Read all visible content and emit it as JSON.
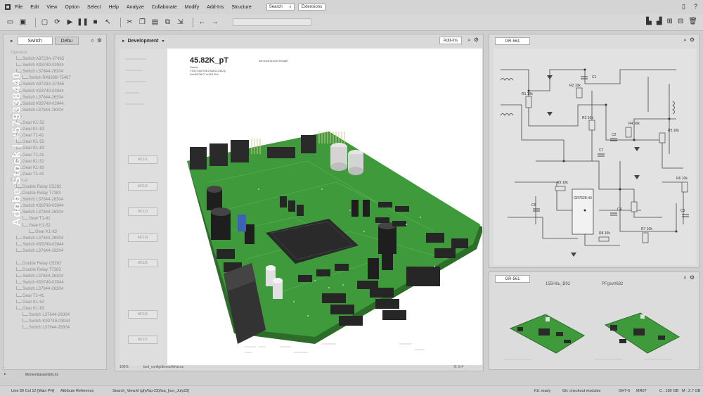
{
  "menu": [
    "File",
    "Edit",
    "View",
    "Option",
    "Select",
    "Help",
    "Analyze",
    "Collaborate",
    "Modify",
    "Add-Ins",
    "Structure"
  ],
  "menu_search": "Search",
  "menu_extensions": "Extensions",
  "toolbar_icons": [
    "folder-icon",
    "save-icon",
    "screen-icon",
    "sync-icon",
    "play-icon",
    "pause-icon",
    "stop-icon",
    "pointer-icon"
  ],
  "left_panel": {
    "tabs": [
      "Switch",
      "Debu"
    ],
    "tree": [
      {
        "label": "Operator",
        "indent": 0,
        "section": true
      },
      {
        "label": "Switch A9723A-37465",
        "indent": 1
      },
      {
        "label": "Switch K93749-03944",
        "indent": 1
      },
      {
        "label": "Switch L37644-26304",
        "indent": 1
      },
      {
        "label": "Switch R4838B-75467",
        "indent": 2
      },
      {
        "label": "Switch A9723A-37465",
        "indent": 1
      },
      {
        "label": "Switch K93749-03944",
        "indent": 1
      },
      {
        "label": "Switch L37644-26304",
        "indent": 1
      },
      {
        "label": "Switch K93749-03944",
        "indent": 1
      },
      {
        "label": "Switch L37644-26304",
        "indent": 1
      },
      {
        "label": "Gears",
        "indent": 0,
        "section": true
      },
      {
        "label": "Gear K1-52",
        "indent": 1
      },
      {
        "label": "Gear K1-83",
        "indent": 1
      },
      {
        "label": "Gear T1-41",
        "indent": 1
      },
      {
        "label": "Gear K1-52",
        "indent": 1
      },
      {
        "label": "Gear K1-83",
        "indent": 1
      },
      {
        "label": "Gear T1-41",
        "indent": 1
      },
      {
        "label": "Gear K1-52",
        "indent": 1
      },
      {
        "label": "Gear K1-83",
        "indent": 1
      },
      {
        "label": "Gear T1-41",
        "indent": 1
      },
      {
        "label": "Electrical",
        "indent": 0,
        "section": true
      },
      {
        "label": "Double Relay C5282",
        "indent": 1
      },
      {
        "label": "Double Relay T7383",
        "indent": 1
      },
      {
        "label": "Switch L37644-26304",
        "indent": 1
      },
      {
        "label": "Switch K93749-03944",
        "indent": 1
      },
      {
        "label": "Switch L37644-26304",
        "indent": 1
      },
      {
        "label": "Gear T1-41",
        "indent": 2
      },
      {
        "label": "Gear K1-52",
        "indent": 2
      },
      {
        "label": "Gear K1-83",
        "indent": 3
      },
      {
        "label": "Switch L37644-26304",
        "indent": 1
      },
      {
        "label": "Switch K93749-03944",
        "indent": 1
      },
      {
        "label": "Switch L37644-26304",
        "indent": 1
      },
      {
        "label": "",
        "indent": 0
      },
      {
        "label": "Double Relay C5282",
        "indent": 1
      },
      {
        "label": "Double Relay T7383",
        "indent": 1
      },
      {
        "label": "Switch L37644-26304",
        "indent": 1
      },
      {
        "label": "Switch K93749-03944",
        "indent": 1
      },
      {
        "label": "Switch L37644-26304",
        "indent": 1
      },
      {
        "label": "Gear T1-41",
        "indent": 1
      },
      {
        "label": "Gear K1-52",
        "indent": 1
      },
      {
        "label": "Gear K1-83",
        "indent": 1
      },
      {
        "label": "Switch L37644-26304",
        "indent": 2
      },
      {
        "label": "Switch K93749-03944",
        "indent": 2
      },
      {
        "label": "Switch L37644-26304",
        "indent": 2
      }
    ],
    "bottom_label": "Moment/assembly.ns"
  },
  "center_panel": {
    "title": "Development",
    "addins": "Add-ins",
    "sidebar_buttons": [
      "MCU1",
      "MCU2",
      "MCU3",
      "MCU4",
      "MCU5",
      "MCU6",
      "MCU7"
    ],
    "board_title": "45.82K_pT",
    "board_sub": [
      "Switch",
      "Y537244578K2938G2234Zp",
      "SecB678K2 Ye3K1Fb4"
    ],
    "board_code": "B8Y623H63H67005867",
    "footer_zoom": "100%",
    "footer_path": "tool_config/drone/drive.cs",
    "footer_right": "G: 5.4"
  },
  "schematic_panel": {
    "tab": "GR-561",
    "labels": [
      "R1 10k",
      "R2 10k",
      "C1",
      "R3 10k",
      "R4 10k",
      "R5 10k",
      "C2",
      "C3",
      "C4",
      "C5",
      "C7",
      "R6 10k",
      "R7 10k",
      "R8 10k",
      "R9 10k",
      "GR7628-43"
    ]
  },
  "preview_panel": {
    "tab": "GR-561",
    "left_title": "155H6u_B92",
    "right_title": "PFgsvt/682"
  },
  "status": {
    "line": "Line 89 Col 12 [Main PH]",
    "attr": "Attribute Reference",
    "path": "Search_View.kl (gfy/fsp-23)/tsa_[run_July23]",
    "kit": "Kit: ready",
    "git": "Git: checkout modules",
    "ghtl": "GHT-6",
    "mr": "MR07",
    "cpu": "C : 180 GB",
    "mem": "M : 2.7 GB"
  },
  "watermark": "Adobe Stock | #579338440",
  "colors": {
    "pcb": "#3e9a3a",
    "pcb_dark": "#2b6d29",
    "chip": "#2a2a2a"
  }
}
